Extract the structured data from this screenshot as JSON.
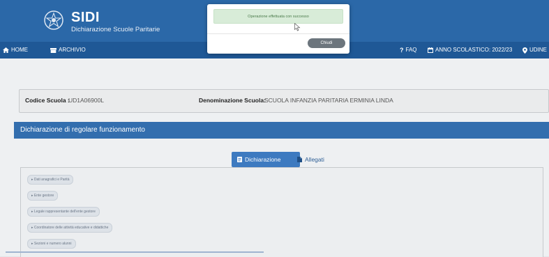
{
  "header": {
    "brand_title": "SIDI",
    "brand_subtitle": "Dichiarazione Scuole Paritarie"
  },
  "nav": {
    "home": "HOME",
    "archivio": "ARCHIVIO",
    "faq": "FAQ",
    "anno_scolastico": "ANNO SCOLASTICO: 2022/23",
    "location": "UDINE"
  },
  "school": {
    "code_label": "Codice Scuola :",
    "code_value": "UD1A06900L",
    "name_label": "Denominazione Scuola:",
    "name_value": "SCUOLA INFANZIA PARITARIA ERMINIA LINDA"
  },
  "section": {
    "title": "Dichiarazione di regolare funzionamento"
  },
  "tabs": [
    {
      "label": "Dichiarazione",
      "active": true
    },
    {
      "label": "Allegati",
      "active": false
    }
  ],
  "accordion": [
    {
      "label": "▸ Dati anagrafici e Parità"
    },
    {
      "label": "▸ Ente gestore"
    },
    {
      "label": "▸ Legale rappresentante dell'ente gestore"
    },
    {
      "label": "▸ Coordinatore delle attività educative e didattiche"
    },
    {
      "label": "▸ Sezioni e numero alunni"
    }
  ],
  "modal": {
    "message": "Operazione effettuata con successo",
    "close_label": "Chiudi"
  },
  "colors": {
    "header_blue": "#2b68a8",
    "nav_blue": "#1f5896",
    "section_blue": "#336eae",
    "tab_active": "#3d7ac0",
    "success_bg": "#d8ecd8",
    "close_button": "#6c757d"
  }
}
